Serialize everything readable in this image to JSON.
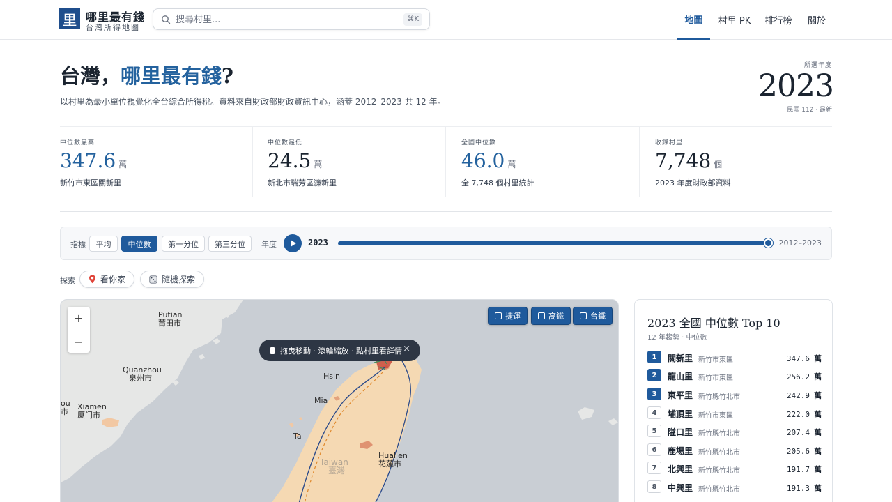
{
  "header": {
    "logo_char": "里",
    "title": "哪里最有錢",
    "subtitle": "台灣所得地圖",
    "search_placeholder": "搜尋村里...",
    "search_shortcut": "⌘K",
    "nav": [
      {
        "label": "地圖",
        "active": true
      },
      {
        "label": "村里 PK",
        "active": false
      },
      {
        "label": "排行榜",
        "active": false
      },
      {
        "label": "關於",
        "active": false
      }
    ]
  },
  "hero": {
    "title_plain": "台灣，",
    "title_highlight": "哪里最有錢",
    "title_end": "?",
    "description": "以村里為最小單位視覺化全台綜合所得稅。資料來自財政部財政資訊中心，涵蓋 2012–2023 共 12 年。",
    "year_label": "所選年度",
    "year": "2023",
    "year_note": "民國 112 · 最新"
  },
  "stats": [
    {
      "label": "中位數最高",
      "value": "347.6",
      "unit": "萬",
      "sub": "新竹市東區關新里"
    },
    {
      "label": "中位數最低",
      "value": "24.5",
      "unit": "萬",
      "sub": "新北市瑞芳區濂新里"
    },
    {
      "label": "全國中位數",
      "value": "46.0",
      "unit": "萬",
      "sub": "全 7,748 個村里統計"
    },
    {
      "label": "收錄村里",
      "value": "7,748",
      "unit": "個",
      "sub": "2023 年度財政部資料"
    }
  ],
  "controls": {
    "metric_label": "指標",
    "metrics": [
      {
        "label": "平均",
        "active": false
      },
      {
        "label": "中位數",
        "active": true
      },
      {
        "label": "第一分位",
        "active": false
      },
      {
        "label": "第三分位",
        "active": false
      }
    ],
    "year_label": "年度",
    "slider_year": "2023",
    "slider_fraction": 1.0,
    "range_label": "2012–2023"
  },
  "explore": {
    "label": "探索",
    "buttons": [
      {
        "label": "看你家",
        "icon": "pin-icon"
      },
      {
        "label": "隨機探索",
        "icon": "dice-icon"
      }
    ]
  },
  "map": {
    "zoom_in": "+",
    "zoom_out": "−",
    "layers": [
      {
        "label": "捷運",
        "icon": "metro-icon"
      },
      {
        "label": "高鐵",
        "icon": "hsr-icon"
      },
      {
        "label": "台鐵",
        "icon": "rail-icon"
      }
    ],
    "hint": "拖曳移動 · 滾輪縮放 · 點村里看詳情",
    "hint_close": "×",
    "labels": {
      "putian_en": "Putian",
      "putian_zh": "莆田市",
      "quanzhou_en": "Quanzhou",
      "quanzhou_zh": "泉州市",
      "xiamen_en": "Xiamen",
      "xiamen_zh": "厦门市",
      "jinmen_en": "ou",
      "jinmen_zh": "市",
      "taiwan_en": "Taiwan",
      "taiwan_zh": "臺灣",
      "hsinchu": "Hsin",
      "miaoli": "Mia",
      "taichung": "Ta",
      "hualien_en": "Hualien",
      "hualien_zh": "花蓮市"
    },
    "colors": {
      "sea": "#c9ced4",
      "land": "#e6e7e6",
      "taiwan": "#f5d9b3",
      "rich": "#d98060"
    }
  },
  "ranking": {
    "title": "2023 全國 中位數 Top 10",
    "subtitle": "12 年趨勢 · 中位數",
    "unit": "萬",
    "items": [
      {
        "rank": "1",
        "name": "關新里",
        "district": "新竹市東區",
        "value": "347.6"
      },
      {
        "rank": "2",
        "name": "龍山里",
        "district": "新竹市東區",
        "value": "256.2"
      },
      {
        "rank": "3",
        "name": "東平里",
        "district": "新竹縣竹北市",
        "value": "242.9"
      },
      {
        "rank": "4",
        "name": "埔頂里",
        "district": "新竹市東區",
        "value": "222.0"
      },
      {
        "rank": "5",
        "name": "隘口里",
        "district": "新竹縣竹北市",
        "value": "207.4"
      },
      {
        "rank": "6",
        "name": "鹿場里",
        "district": "新竹縣竹北市",
        "value": "205.6"
      },
      {
        "rank": "7",
        "name": "北興里",
        "district": "新竹縣竹北市",
        "value": "191.7"
      },
      {
        "rank": "8",
        "name": "中興里",
        "district": "新竹縣竹北市",
        "value": "191.3"
      }
    ]
  },
  "colors": {
    "accent": "#1f5a9c",
    "highlight": "#24629e",
    "text": "#1b2430"
  }
}
